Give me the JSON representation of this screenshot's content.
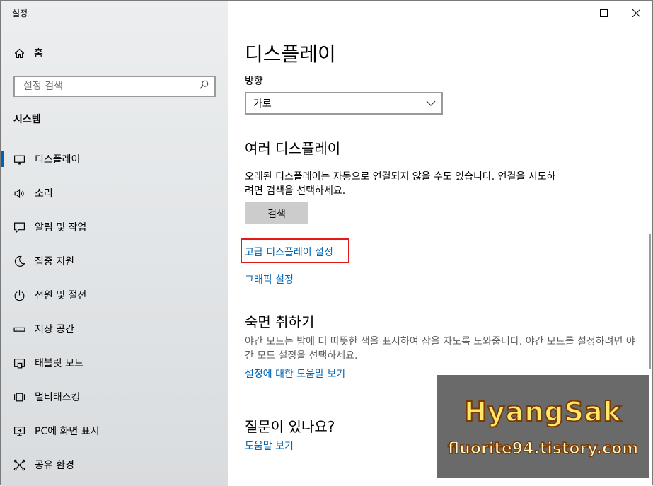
{
  "window": {
    "title": "설정",
    "controls": {
      "minimize": "—",
      "maximize": "☐",
      "close": "✕"
    }
  },
  "sidebar": {
    "home_label": "홈",
    "search_placeholder": "설정 검색",
    "section_title": "시스템",
    "items": [
      {
        "label": "디스플레이",
        "icon": "monitor-icon",
        "active": true
      },
      {
        "label": "소리",
        "icon": "speaker-icon"
      },
      {
        "label": "알림 및 작업",
        "icon": "notification-icon"
      },
      {
        "label": "집중 지원",
        "icon": "moon-icon"
      },
      {
        "label": "전원 및 절전",
        "icon": "power-icon"
      },
      {
        "label": "저장 공간",
        "icon": "storage-icon"
      },
      {
        "label": "태블릿 모드",
        "icon": "tablet-icon"
      },
      {
        "label": "멀티태스킹",
        "icon": "multitask-icon"
      },
      {
        "label": "PC에 화면 표시",
        "icon": "project-icon"
      },
      {
        "label": "공유 환경",
        "icon": "share-icon"
      }
    ]
  },
  "main": {
    "title": "디스플레이",
    "orientation_label": "방향",
    "orientation_value": "가로",
    "multi_display": {
      "heading": "여러 디스플레이",
      "description": "오래된 디스플레이는 자동으로 연결되지 않을 수도 있습니다. 연결을 시도하려면 검색을 선택하세요.",
      "detect_button": "검색"
    },
    "advanced_link": "고급 디스플레이 설정",
    "graphics_link": "그래픽 설정",
    "night_light": {
      "heading": "숙면 취하기",
      "description": "야간 모드는 밤에 더 따뜻한 색을 표시하여 잠을 자도록 도와줍니다. 야간 모드를 설정하려면 야간 모드 설정을 선택하세요.",
      "help_link": "설정에 대한 도움말 보기"
    },
    "question": {
      "heading": "질문이 있나요?",
      "help_link": "도움말 보기"
    }
  },
  "watermark": {
    "name": "HyangSak",
    "url": "fluorite94.tistory.com"
  },
  "colors": {
    "accent": "#0063b1",
    "link": "#0067b8",
    "highlight": "#e41a1a"
  }
}
